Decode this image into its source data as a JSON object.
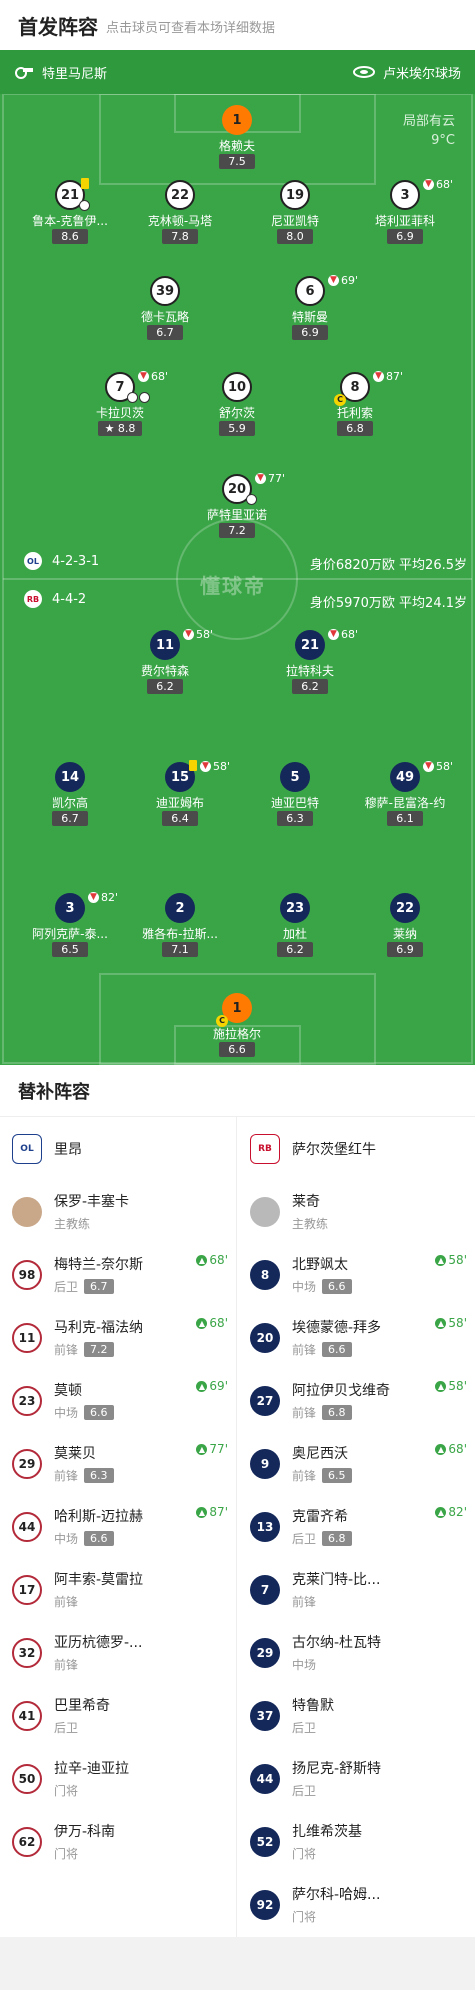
{
  "header": {
    "title": "首发阵容",
    "subtitle": "点击球员可查看本场详细数据"
  },
  "pitch": {
    "referee": "特里马尼斯",
    "stadium": "卢米埃尔球场",
    "weather": "局部有云",
    "temperature": "9°C",
    "watermark": "懂球帝",
    "home": {
      "crest": "OL",
      "formation": "4-2-3-1",
      "value": "身价6820万欧 平均26.5岁"
    },
    "away": {
      "crest": "RB",
      "formation": "4-4-2",
      "value": "身价5970万欧 平均24.1岁"
    }
  },
  "home_players": [
    {
      "num": "1",
      "name": "格赖夫",
      "rating": "7.5"
    },
    {
      "num": "21",
      "name": "鲁本-克鲁伊...",
      "rating": "8.6"
    },
    {
      "num": "22",
      "name": "克林顿-马塔",
      "rating": "7.8"
    },
    {
      "num": "19",
      "name": "尼亚凯特",
      "rating": "8.0"
    },
    {
      "num": "3",
      "name": "塔利亚菲科",
      "rating": "6.9",
      "sub": "68'"
    },
    {
      "num": "39",
      "name": "德卡瓦略",
      "rating": "6.7"
    },
    {
      "num": "6",
      "name": "特斯曼",
      "rating": "6.9",
      "sub": "69'"
    },
    {
      "num": "7",
      "name": "卡拉贝茨",
      "rating": "8.8",
      "sub": "68'"
    },
    {
      "num": "10",
      "name": "舒尔茨",
      "rating": "5.9"
    },
    {
      "num": "8",
      "name": "托利索",
      "rating": "6.8",
      "sub": "87'"
    },
    {
      "num": "20",
      "name": "萨特里亚诺",
      "rating": "7.2",
      "sub": "77'"
    }
  ],
  "away_players": [
    {
      "num": "11",
      "name": "费尔特森",
      "rating": "6.2",
      "sub": "58'"
    },
    {
      "num": "21",
      "name": "拉特科夫",
      "rating": "6.2",
      "sub": "68'"
    },
    {
      "num": "14",
      "name": "凯尔高",
      "rating": "6.7"
    },
    {
      "num": "15",
      "name": "迪亚姆布",
      "rating": "6.4",
      "sub": "58'"
    },
    {
      "num": "5",
      "name": "迪亚巴特",
      "rating": "6.3"
    },
    {
      "num": "49",
      "name": "穆萨-昆富洛-约",
      "rating": "6.1",
      "sub": "58'"
    },
    {
      "num": "3",
      "name": "阿列克萨-泰...",
      "rating": "6.5",
      "sub": "82'"
    },
    {
      "num": "2",
      "name": "雅各布-拉斯...",
      "rating": "7.1"
    },
    {
      "num": "23",
      "name": "加杜",
      "rating": "6.2"
    },
    {
      "num": "22",
      "name": "莱纳",
      "rating": "6.9"
    },
    {
      "num": "1",
      "name": "施拉格尔",
      "rating": "6.6"
    }
  ],
  "cap_label": "C",
  "subs": {
    "title": "替补阵容",
    "home": {
      "team": "里昂",
      "team_logo": "OL",
      "coach": "保罗-丰塞卡",
      "coach_role": "主教练",
      "players": [
        {
          "num": "98",
          "name": "梅特兰-奈尔斯",
          "pos": "后卫",
          "rating": "6.7",
          "in": "68'"
        },
        {
          "num": "11",
          "name": "马利克-福法纳",
          "pos": "前锋",
          "rating": "7.2",
          "in": "68'"
        },
        {
          "num": "23",
          "name": "莫顿",
          "pos": "中场",
          "rating": "6.6",
          "in": "69'"
        },
        {
          "num": "29",
          "name": "莫莱贝",
          "pos": "前锋",
          "rating": "6.3",
          "in": "77'"
        },
        {
          "num": "44",
          "name": "哈利斯-迈拉赫",
          "pos": "中场",
          "rating": "6.6",
          "in": "87'"
        },
        {
          "num": "17",
          "name": "阿丰索-莫雷拉",
          "pos": "前锋"
        },
        {
          "num": "32",
          "name": "亚历杭德罗-...",
          "pos": "前锋"
        },
        {
          "num": "41",
          "name": "巴里希奇",
          "pos": "后卫"
        },
        {
          "num": "50",
          "name": "拉辛-迪亚拉",
          "pos": "门将"
        },
        {
          "num": "62",
          "name": "伊万-科南",
          "pos": "门将"
        }
      ]
    },
    "away": {
      "team": "萨尔茨堡红牛",
      "team_logo": "RB",
      "coach": "莱奇",
      "coach_role": "主教练",
      "players": [
        {
          "num": "8",
          "name": "北野飒太",
          "pos": "中场",
          "rating": "6.6",
          "in": "58'"
        },
        {
          "num": "20",
          "name": "埃德蒙德-拜多",
          "pos": "前锋",
          "rating": "6.6",
          "in": "58'"
        },
        {
          "num": "27",
          "name": "阿拉伊贝戈维奇",
          "pos": "前锋",
          "rating": "6.8",
          "in": "58'"
        },
        {
          "num": "9",
          "name": "奥尼西沃",
          "pos": "前锋",
          "rating": "6.5",
          "in": "68'"
        },
        {
          "num": "13",
          "name": "克雷齐希",
          "pos": "后卫",
          "rating": "6.8",
          "in": "82'"
        },
        {
          "num": "7",
          "name": "克莱门特-比...",
          "pos": "前锋"
        },
        {
          "num": "29",
          "name": "古尔纳-杜瓦特",
          "pos": "中场"
        },
        {
          "num": "37",
          "name": "特鲁默",
          "pos": "后卫"
        },
        {
          "num": "44",
          "name": "扬尼克-舒斯特",
          "pos": "后卫"
        },
        {
          "num": "52",
          "name": "扎维希茨基",
          "pos": "门将"
        },
        {
          "num": "92",
          "name": "萨尔科-哈姆...",
          "pos": "门将"
        }
      ]
    }
  },
  "colors": {
    "pitch": "#3aa547",
    "home_ring": "#222222",
    "away_fill": "#14285a",
    "sub_green": "#3aa547"
  }
}
